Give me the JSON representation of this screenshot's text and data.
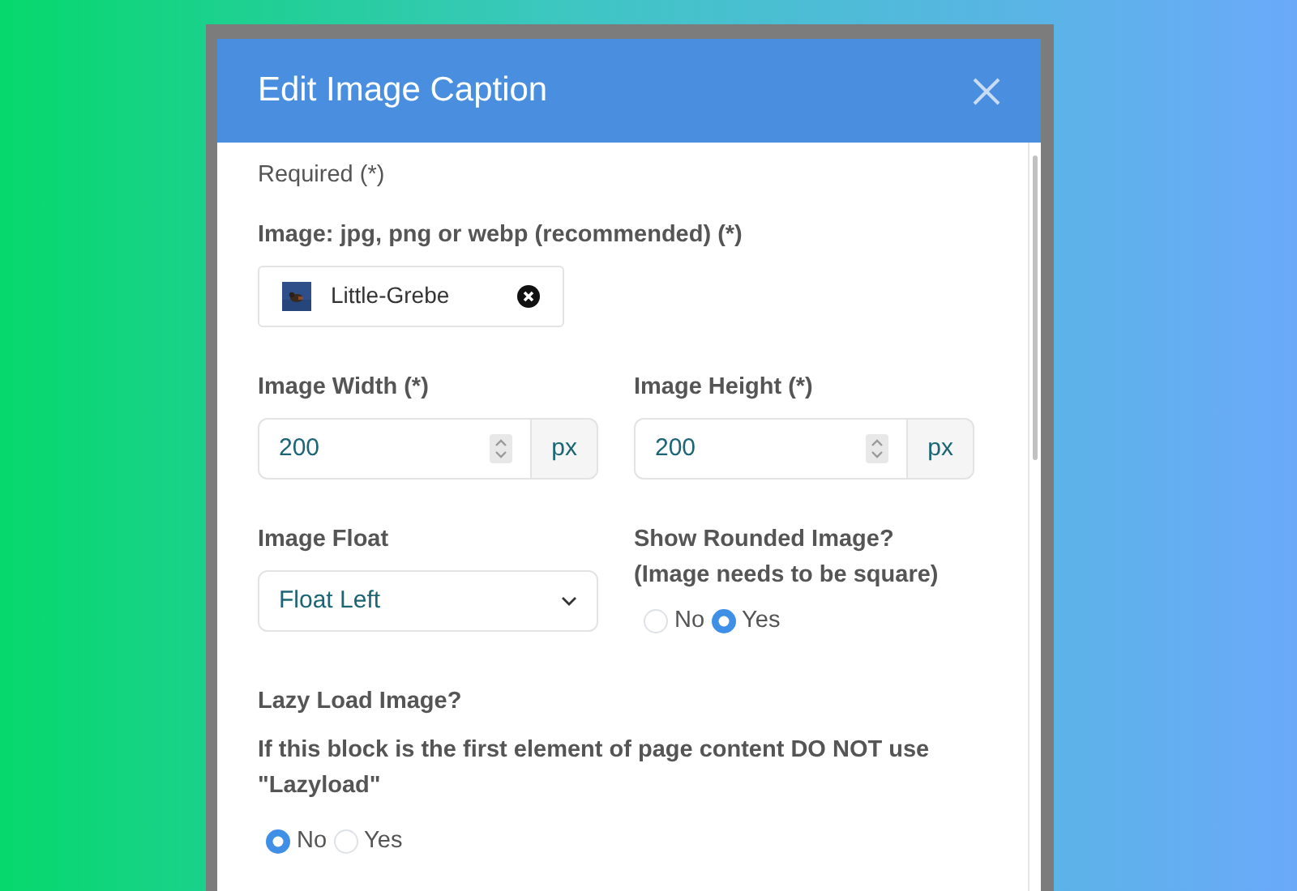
{
  "modal": {
    "title": "Edit Image Caption"
  },
  "required_note": "Required (*)",
  "image": {
    "label": "Image: jpg, png or webp (recommended) (*)",
    "file": "Little-Grebe"
  },
  "width": {
    "label": "Image Width (*)",
    "value": "200",
    "unit": "px"
  },
  "height": {
    "label": "Image Height (*)",
    "value": "200",
    "unit": "px"
  },
  "float": {
    "label": "Image Float",
    "value": "Float Left"
  },
  "rounded": {
    "label": "Show Rounded Image?",
    "note": "(Image needs to be square)",
    "options": [
      {
        "label": "No",
        "selected": false
      },
      {
        "label": "Yes",
        "selected": true
      }
    ]
  },
  "lazy": {
    "label": "Lazy Load Image?",
    "warning": "If this block is the first element of page content DO NOT use \"Lazyload\"",
    "options": [
      {
        "label": "No",
        "selected": true
      },
      {
        "label": "Yes",
        "selected": false
      }
    ]
  }
}
